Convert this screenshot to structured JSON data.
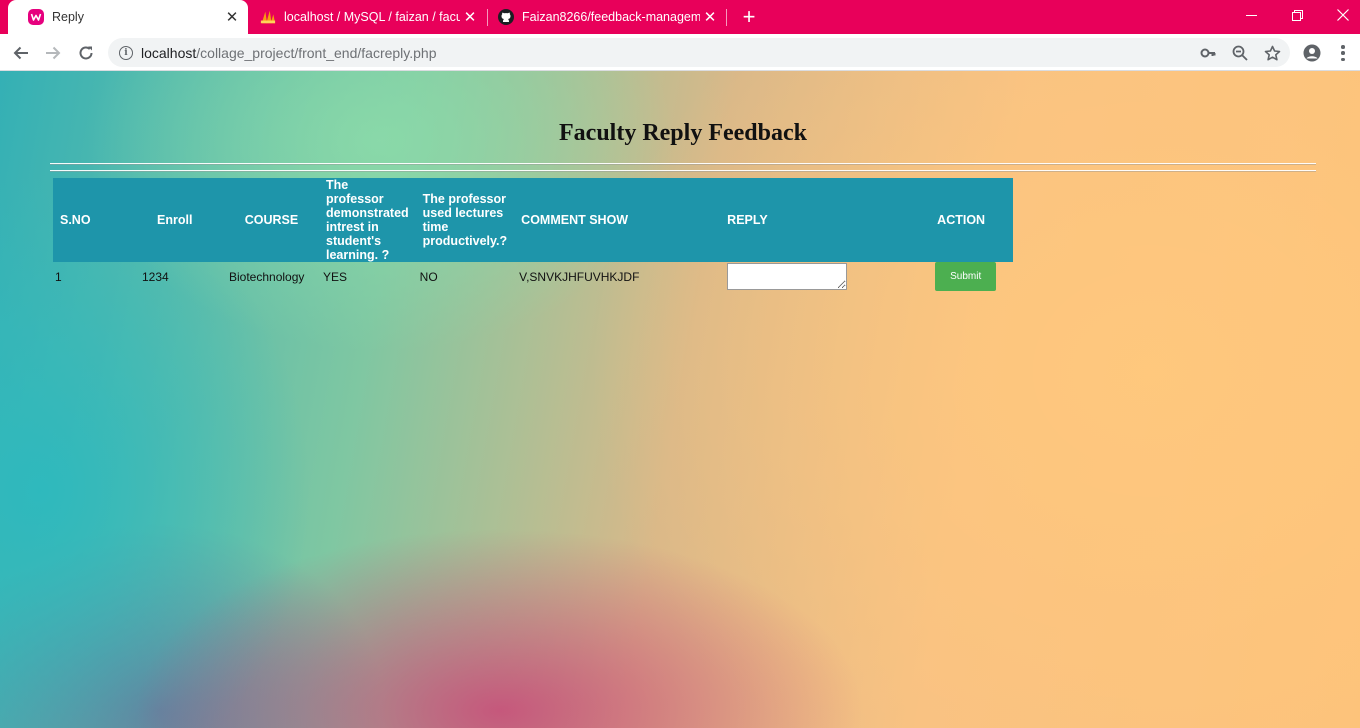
{
  "browser": {
    "tabs": [
      {
        "title": "Reply",
        "icon": "wamp-icon",
        "active": true
      },
      {
        "title": "localhost / MySQL / faizan / facul",
        "icon": "phpmyadmin-icon",
        "active": false
      },
      {
        "title": "Faizan8266/feedback-manageme",
        "icon": "github-icon",
        "active": false
      }
    ],
    "url_host": "localhost",
    "url_path": "/collage_project/front_end/facreply.php",
    "tab_bar_color": "#e8005a"
  },
  "page": {
    "title": "Faculty Reply Feedback",
    "table": {
      "header_color": "#1e95aa",
      "columns": [
        "S.NO",
        "Enroll",
        "COURSE",
        "The professor demonstrated intrest in student's learning. ?",
        "The professor used lectures time productively.?",
        "COMMENT SHOW",
        "REPLY",
        "ACTION"
      ],
      "rows": [
        {
          "sno": "1",
          "enroll": "1234",
          "course": "Biotechnology",
          "q1": "YES",
          "q2": "NO",
          "comment": "V,SNVKJHFUVHKJDF",
          "reply": "",
          "action_label": "Submit"
        }
      ]
    },
    "submit_color": "#4caf50"
  }
}
